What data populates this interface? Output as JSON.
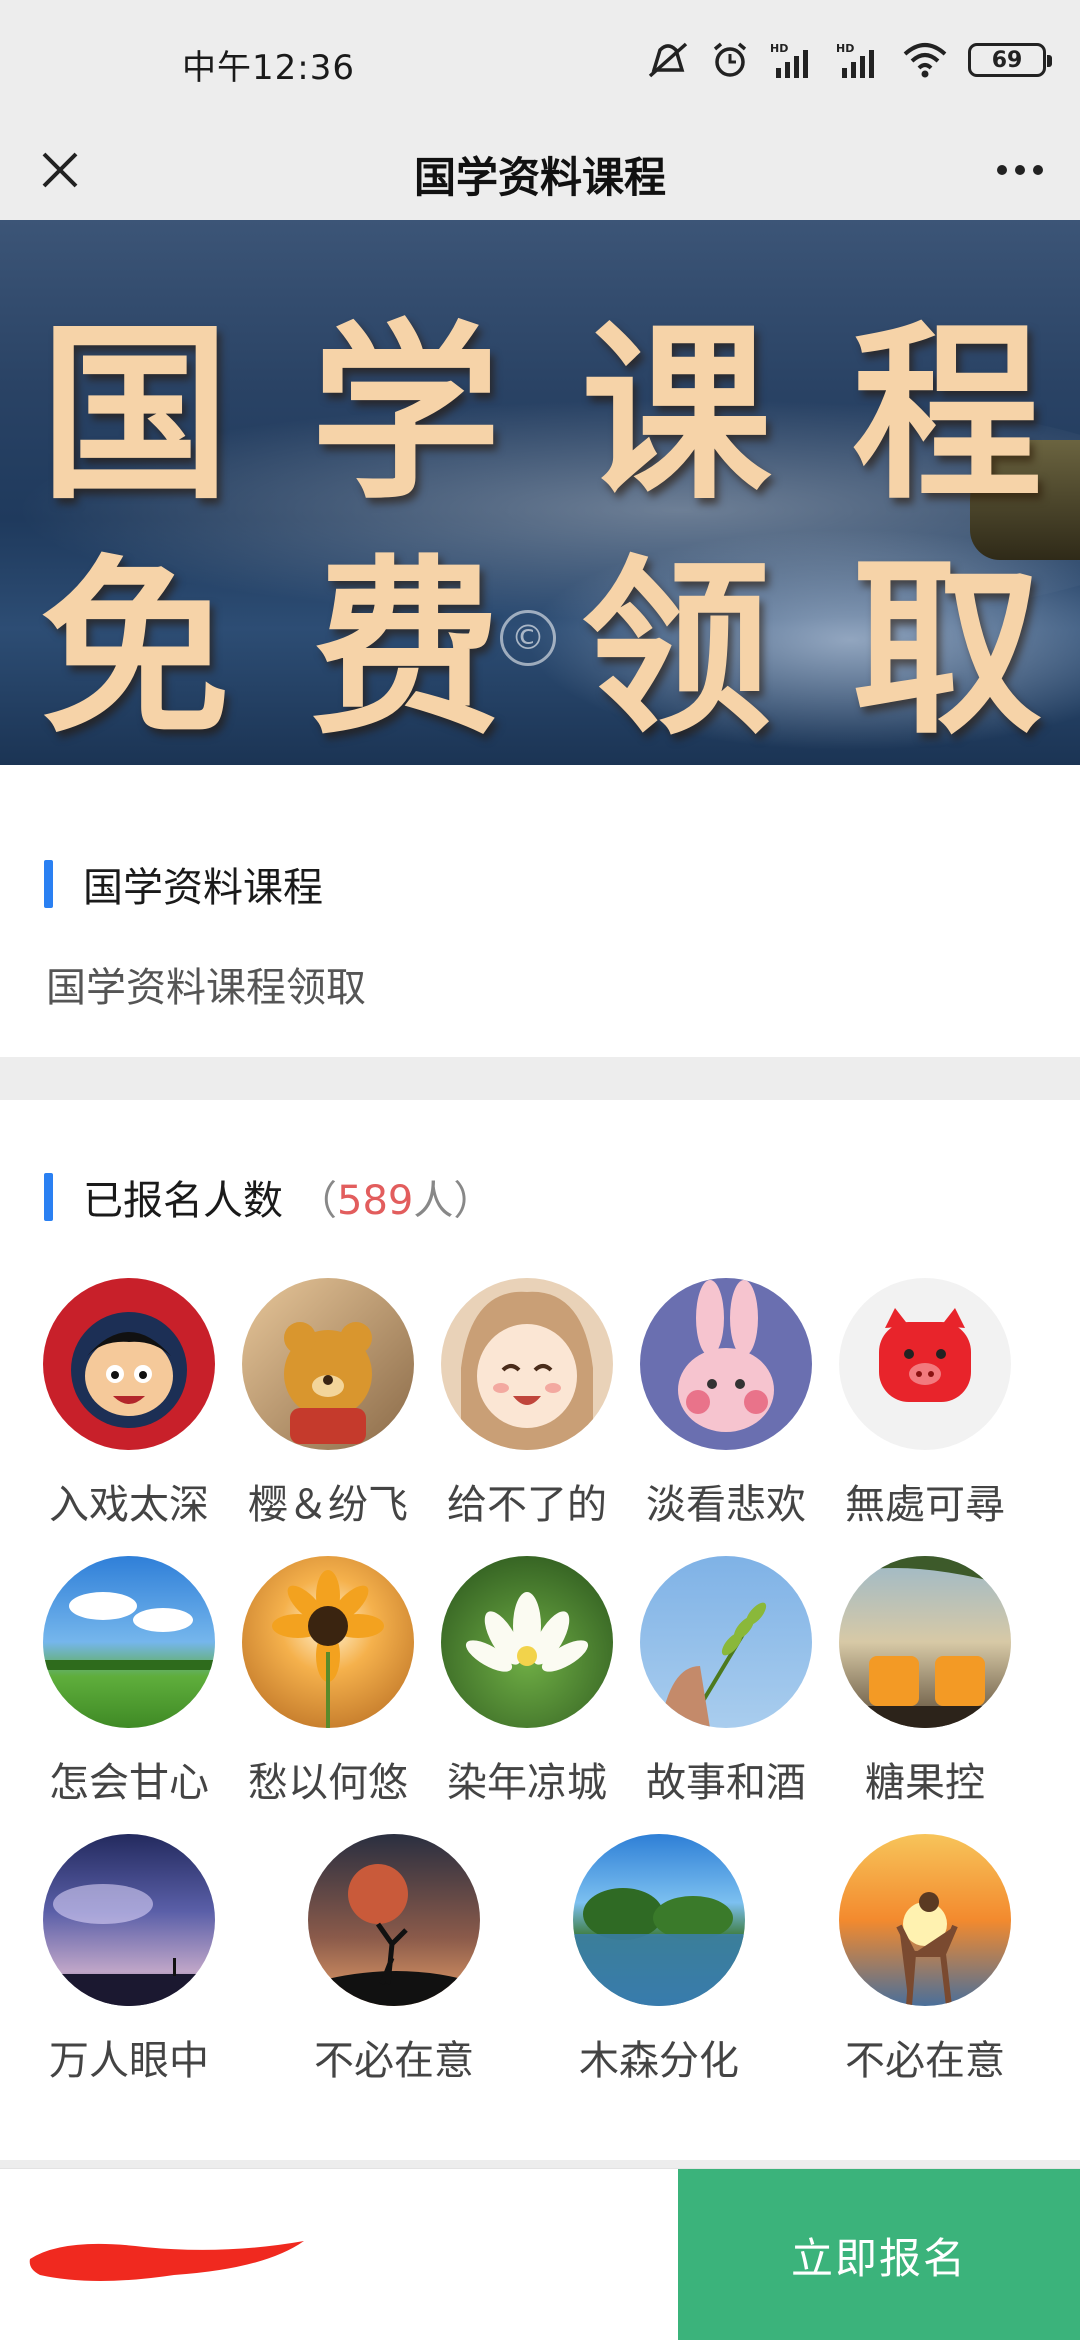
{
  "status_bar": {
    "time": "中午12:36",
    "battery": "69"
  },
  "title_bar": {
    "title": "国学资料课程"
  },
  "banner": {
    "line1": [
      "国",
      "学",
      "课",
      "程"
    ],
    "line2": [
      "免",
      "费",
      "领",
      "取"
    ],
    "copyright_mark": "©"
  },
  "course": {
    "title": "国学资料课程",
    "description": "国学资料课程领取"
  },
  "enrollment": {
    "label": "已报名人数",
    "open_paren": "（",
    "count": "589",
    "unit": "人）",
    "people": [
      {
        "name": "入戏太深"
      },
      {
        "name": "樱＆纷飞"
      },
      {
        "name": "给不了的"
      },
      {
        "name": "淡看悲欢"
      },
      {
        "name": "無處可尋"
      },
      {
        "name": "怎会甘心"
      },
      {
        "name": "愁以何悠"
      },
      {
        "name": "染年凉城"
      },
      {
        "name": "故事和酒"
      },
      {
        "name": "糖果控"
      },
      {
        "name": "万人眼中"
      },
      {
        "name": "不必在意"
      },
      {
        "name": "木森分化"
      },
      {
        "name": "不必在意"
      }
    ]
  },
  "bottom_bar": {
    "signup_label": "立即报名"
  },
  "colors": {
    "accent_blue": "#2a80f2",
    "count_red": "#e25d5d",
    "signup_green": "#3bb37b"
  }
}
